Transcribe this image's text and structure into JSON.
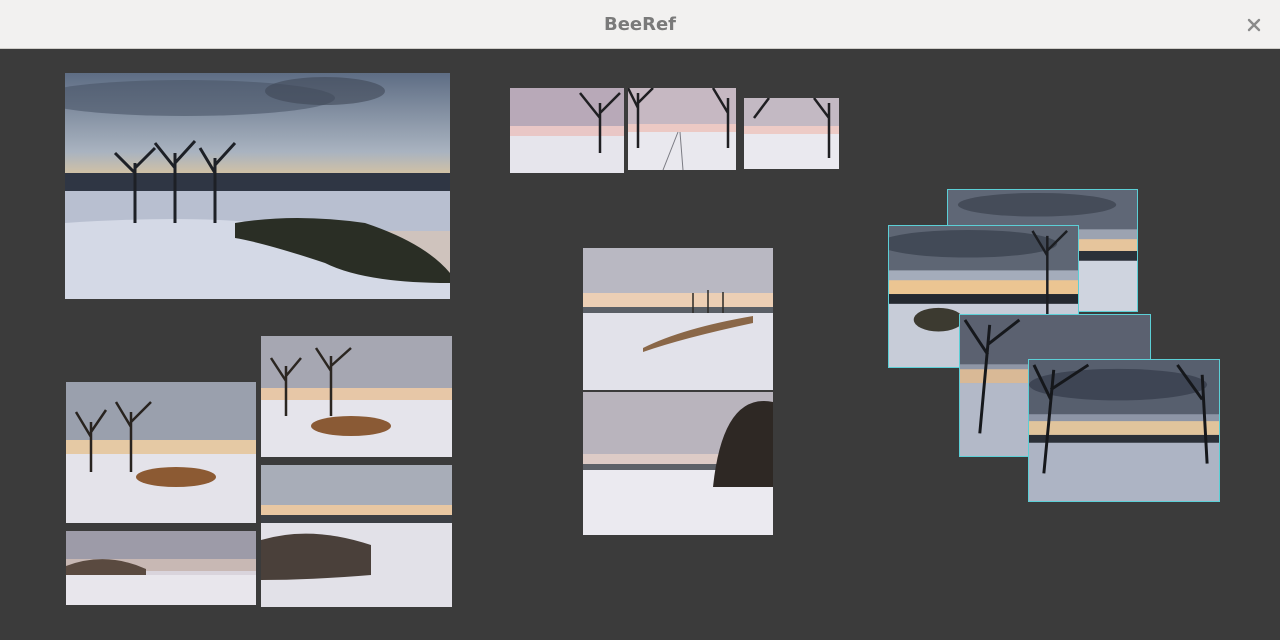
{
  "window": {
    "title": "BeeRef"
  },
  "colors": {
    "canvas": "#3b3b3b",
    "titlebar": "#f2f1f0",
    "selection": "#5ccfd6"
  },
  "icons": {
    "close": "close-icon"
  },
  "images": [
    {
      "id": "lake-sunset",
      "scene": "lake",
      "selected": false
    },
    {
      "id": "trees-snow-1",
      "scene": "trees",
      "selected": false
    },
    {
      "id": "trees-snow-2",
      "scene": "trees",
      "selected": false
    },
    {
      "id": "field-fog",
      "scene": "field",
      "selected": false
    },
    {
      "id": "field-bushes",
      "scene": "bushes",
      "selected": false
    },
    {
      "id": "strip-1",
      "scene": "strip",
      "selected": false
    },
    {
      "id": "strip-2",
      "scene": "strip",
      "selected": false
    },
    {
      "id": "strip-3",
      "scene": "strip",
      "selected": false
    },
    {
      "id": "center-1",
      "scene": "field",
      "selected": false
    },
    {
      "id": "center-2",
      "scene": "trees-right",
      "selected": false
    },
    {
      "id": "sel-1",
      "scene": "cloudy",
      "selected": true
    },
    {
      "id": "sel-2",
      "scene": "cloudy-tree",
      "selected": true
    },
    {
      "id": "sel-3",
      "scene": "dark-tree",
      "selected": true
    },
    {
      "id": "sel-4",
      "scene": "dark-tree",
      "selected": true
    }
  ]
}
